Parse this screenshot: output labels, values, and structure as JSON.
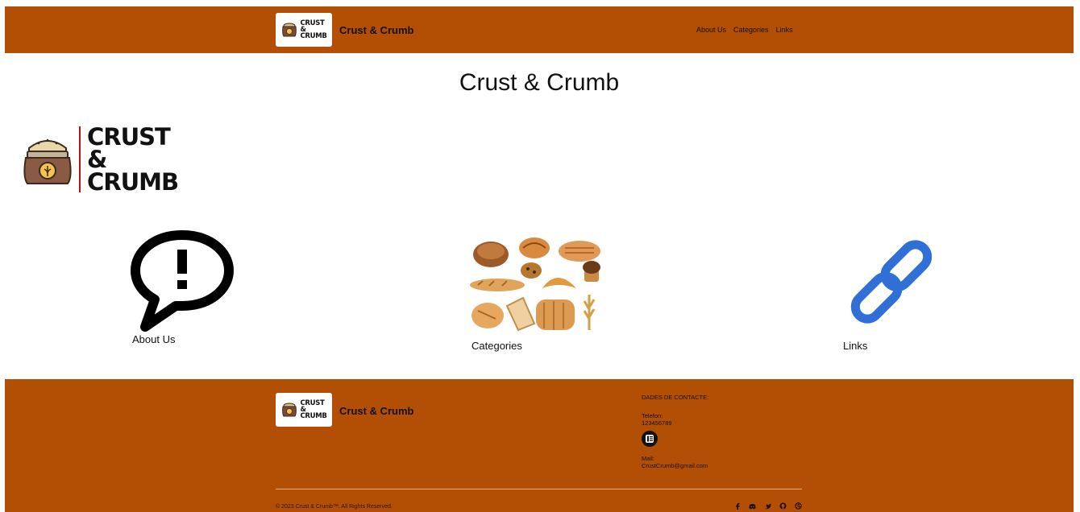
{
  "header": {
    "logo": {
      "line1": "CRUST",
      "line2": "&",
      "line3": "CRUMB"
    },
    "brand_name": "Crust & Crumb",
    "nav": [
      "About Us",
      "Categories",
      "Links"
    ]
  },
  "main": {
    "title": "Crust & Crumb",
    "hero_logo": {
      "line1": "CRUST",
      "line2": "&",
      "line3": "CRUMB"
    },
    "cards": [
      {
        "label": "About Us",
        "icon": "speech-bubble-exclamation-icon"
      },
      {
        "label": "Categories",
        "icon": "bread-assortment-icon"
      },
      {
        "label": "Links",
        "icon": "chain-link-icon"
      }
    ]
  },
  "footer": {
    "brand_name": "Crust & Crumb",
    "logo": {
      "line1": "CRUST",
      "line2": "&",
      "line3": "CRUMB"
    },
    "contact_heading": "DADES DE CONTACTE:",
    "phone_label": "Telefon:",
    "phone_value": "123456789",
    "mail_label": "Mail:",
    "mail_value": "CrustCrumb@gmail.com",
    "copyright": "© 2023 Crust & Crumb™. All Rights Reserved.",
    "socials": [
      "facebook-icon",
      "discord-icon",
      "twitter-icon",
      "github-icon",
      "dribbble-icon"
    ]
  },
  "colors": {
    "brand": "#b24f04",
    "accent_red": "#b5121b",
    "link_blue": "#2f6fd6"
  }
}
